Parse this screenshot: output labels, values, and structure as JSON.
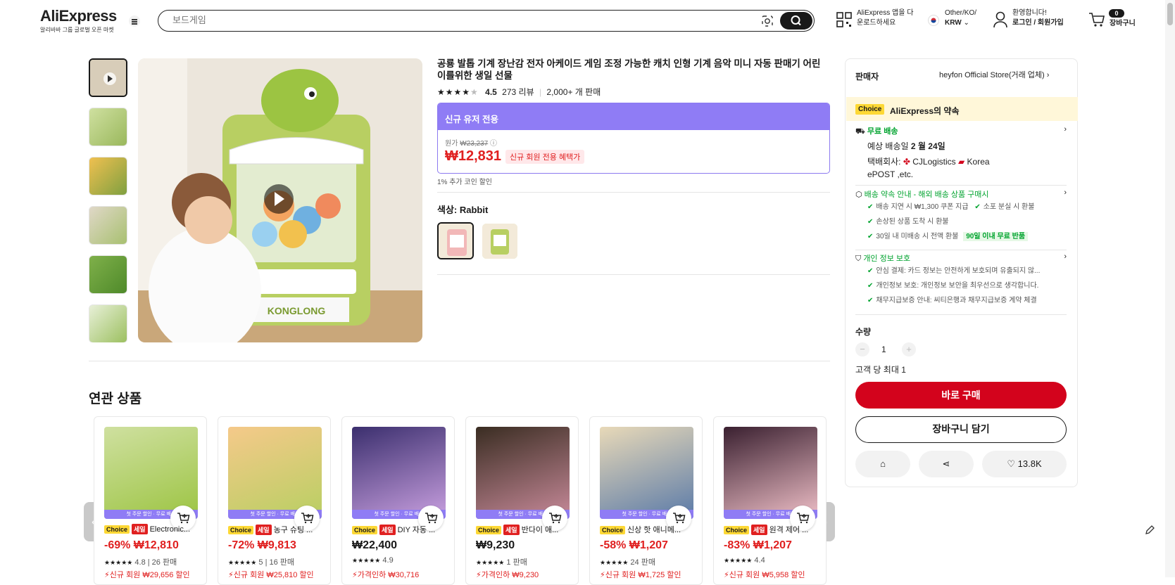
{
  "header": {
    "logo_title": "AliExpress",
    "logo_sub": "알리바바 그룹 글로벌 오픈 마켓",
    "search_placeholder": "보드게임",
    "app_line1": "AliExpress 앱을 다",
    "app_line2": "운로드하세요",
    "locale_line1": "Other/KO/",
    "locale_line2": "KRW",
    "user_line1": "환영합니다!",
    "user_line2": "로그인 / 회원가입",
    "cart_count": "0",
    "cart_label": "장바구니"
  },
  "product": {
    "title": "공룡 발톱 기계 장난감 전자 아케이드 게임 조정 가능한 캐치 인형 기계 음악 미니 자동 판매기 어린이를위한 생일 선물",
    "rating": "4.5",
    "reviews": "273 리뷰",
    "sold": "2,000+ 개 판매",
    "promo_header": "신규 유저 전용",
    "orig_label": "원가",
    "orig_price": "₩23,237",
    "price": "₩12,831",
    "price_tag": "신규 회원 전용 혜택가",
    "coin_note": "1% 추가 코인 할인",
    "color_label": "색상: Rabbit"
  },
  "seller": {
    "label": "판매자",
    "name": "heyfon Official Store(거래 업체)",
    "choice_badge": "Choice",
    "choice_text": "AliExpress의 약속",
    "free_ship": "무료 배송",
    "delivery_prefix": "예상 배송일",
    "delivery_date": "2 월 24일",
    "carrier_label": "택배회사:",
    "carrier1": "CJLogistics",
    "carrier2": "Korea",
    "carrier3": "ePOST ,etc.",
    "promise_title": "배송 약속 안내 - 해외 배송 상품 구매시",
    "promise1": "배송 지연 시 ₩1,300 쿠폰 지급",
    "promise2": "소포 분실 시 환불",
    "promise3": "손상된 상품 도착 시 환불",
    "promise4": "30일 내 미배송 시 전액 환불",
    "promise4_tag": "90일 이내 무료 반품",
    "privacy_title": "개인 정보 보호",
    "privacy1": "안심 결제: 카드 정보는 안전하게 보호되며 유출되지 않...",
    "privacy2": "개인정보 보호: 개인정보 보안을 최우선으로 생각합니다.",
    "privacy3": "채무지급보증 안내: 씨티은행과 채무지급보증 계약 체결",
    "qty_label": "수량",
    "qty_value": "1",
    "qty_limit": "고객 당 최대 1",
    "buy_now": "바로 구매",
    "add_cart": "장바구니 담기",
    "wish_count": "13.8K"
  },
  "related": {
    "title": "연관 상품",
    "strip_text": "첫 주문 할인 · 무료 배송",
    "cards": [
      {
        "badge_choice": "Choice",
        "badge_sale": "세일",
        "name": "Electronic...",
        "price": "-69% ₩12,810",
        "stats": "4.8 | 26 판매",
        "note": "신규 회원 ₩29,656 할인"
      },
      {
        "badge_choice": "Choice",
        "badge_sale": "세일",
        "name": "농구 슈팅 ...",
        "price": "-72% ₩9,813",
        "stats": "5 | 16 판매",
        "note": "신규 회원 ₩25,810 할인"
      },
      {
        "badge_choice": "Choice",
        "badge_sale": "세일",
        "name": "DIY 자동 ...",
        "price": "₩22,400",
        "stats": "4.9",
        "note": "가격인하 ₩30,716"
      },
      {
        "badge_choice": "Choice",
        "badge_sale": "세일",
        "name": "반다이 애...",
        "price": "₩9,230",
        "stats": "1 판매",
        "note": "가격인하 ₩9,230"
      },
      {
        "badge_choice": "Choice",
        "badge_sale": "",
        "name": "신상 핫 애니메...",
        "price": "-58% ₩1,207",
        "stats": "24 판매",
        "note": "신규 회원 ₩1,725 할인"
      },
      {
        "badge_choice": "Choice",
        "badge_sale": "세일",
        "name": "원격 제어 ...",
        "price": "-83% ₩1,207",
        "stats": "4.4",
        "note": "신규 회원 ₩5,958 할인"
      }
    ]
  }
}
